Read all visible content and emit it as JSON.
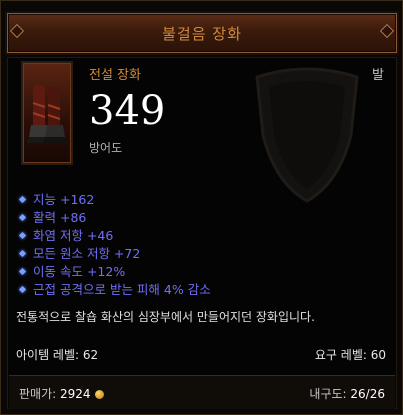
{
  "item": {
    "name": "불걸음 장화",
    "type": "전설 장화",
    "slot": "발",
    "armor_value": "349",
    "armor_label": "방어도"
  },
  "stats": [
    "지능 +162",
    "활력 +86",
    "화염 저항 +46",
    "모든 원소 저항 +72",
    "이동 속도 +12%",
    "근접 공격으로 받는 피해 4% 감소"
  ],
  "flavor_text": "전통적으로 찰숍 화산의 심장부에서 만들어지던 장화입니다.",
  "requirements": {
    "item_level_label": "아이템 레벨: 62",
    "required_level_label": "요구 레벨: 60"
  },
  "footer": {
    "sell_label": "판매가:",
    "sell_value": "2924",
    "durability_label": "내구도:",
    "durability_value": "26/26"
  },
  "icons": {
    "coin": "gold-coin-icon",
    "bullet": "diamond-bullet-icon",
    "item": "boots-icon"
  },
  "colors": {
    "title": "#d08a3a",
    "legendary": "#d08a3a",
    "magic_stat": "#6f6ff5"
  }
}
